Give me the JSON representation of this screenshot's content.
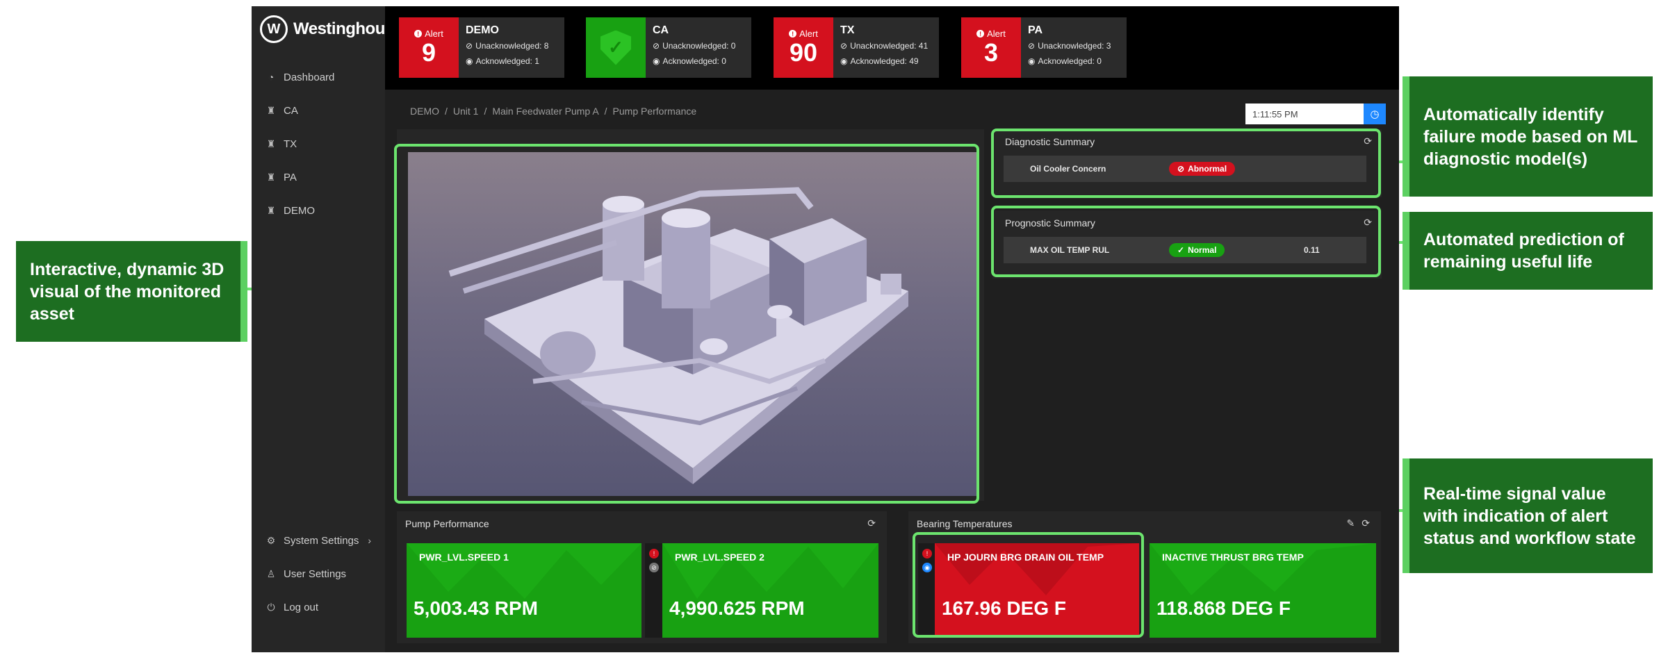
{
  "brand": {
    "name": "Westinghouse",
    "mark": "W"
  },
  "sidebar": {
    "items": [
      {
        "label": "Dashboard",
        "icon": "dashboard-icon",
        "glyph": "◔"
      },
      {
        "label": "CA",
        "icon": "plant-icon",
        "glyph": "♜"
      },
      {
        "label": "TX",
        "icon": "plant-icon",
        "glyph": "♜"
      },
      {
        "label": "PA",
        "icon": "plant-icon",
        "glyph": "♜"
      },
      {
        "label": "DEMO",
        "icon": "plant-icon",
        "glyph": "♜"
      }
    ],
    "footer": [
      {
        "label": "System Settings",
        "icon": "gear-icon",
        "glyph": "⚙",
        "chevron": "›"
      },
      {
        "label": "User Settings",
        "icon": "user-icon",
        "glyph": "♙"
      },
      {
        "label": "Log out",
        "icon": "power-icon",
        "glyph": "⏻"
      }
    ]
  },
  "alerts": [
    {
      "badge_label": "Alert",
      "count": "9",
      "status": "alert",
      "site": "DEMO",
      "unack": "Unacknowledged: 8",
      "ack": "Acknowledged: 1"
    },
    {
      "badge_label": "",
      "count": "",
      "status": "ok",
      "site": "CA",
      "unack": "Unacknowledged: 0",
      "ack": "Acknowledged: 0"
    },
    {
      "badge_label": "Alert",
      "count": "90",
      "status": "alert",
      "site": "TX",
      "unack": "Unacknowledged: 41",
      "ack": "Acknowledged: 49"
    },
    {
      "badge_label": "Alert",
      "count": "3",
      "status": "alert",
      "site": "PA",
      "unack": "Unacknowledged: 3",
      "ack": "Acknowledged: 0"
    }
  ],
  "breadcrumb": [
    "DEMO",
    "Unit 1",
    "Main Feedwater Pump A",
    "Pump Performance"
  ],
  "breadcrumb_sep": "/",
  "time": {
    "value": "1:11:55 PM",
    "button_glyph": "◷"
  },
  "diagnostic": {
    "title": "Diagnostic Summary",
    "row": {
      "name": "Oil Cooler Concern",
      "status": "Abnormal",
      "status_glyph": "⊘"
    }
  },
  "prognostic": {
    "title": "Prognostic Summary",
    "row": {
      "name": "MAX OIL TEMP RUL",
      "status": "Normal",
      "status_glyph": "✓",
      "value": "0.11"
    }
  },
  "pump_performance": {
    "title": "Pump Performance",
    "signals": [
      {
        "name": "PWR_LVL.SPEED 1",
        "value": "5,003.43 RPM",
        "state": "normal"
      },
      {
        "name": "PWR_LVL.SPEED 2",
        "value": "4,990.625 RPM",
        "state": "normal"
      }
    ]
  },
  "bearing_temps": {
    "title": "Bearing Temperatures",
    "signals": [
      {
        "name": "HP JOURN BRG DRAIN OIL TEMP",
        "value": "167.96 DEG F",
        "state": "alert"
      },
      {
        "name": "INACTIVE THRUST BRG TEMP",
        "value": "118.868 DEG F",
        "state": "normal"
      }
    ]
  },
  "callouts": {
    "left": "Interactive, dynamic 3D visual of the monitored asset",
    "diag": "Automatically identify failure mode based on ML diagnostic model(s)",
    "prog": "Automated prediction of remaining useful life",
    "signal": "Real-time signal value with indication of alert status and workflow state"
  },
  "colors": {
    "alert_red": "#d4111e",
    "ok_green": "#18a112",
    "callout_green": "#1d6e21",
    "highlight": "#6ce46e",
    "accent_blue": "#1e88ff"
  }
}
